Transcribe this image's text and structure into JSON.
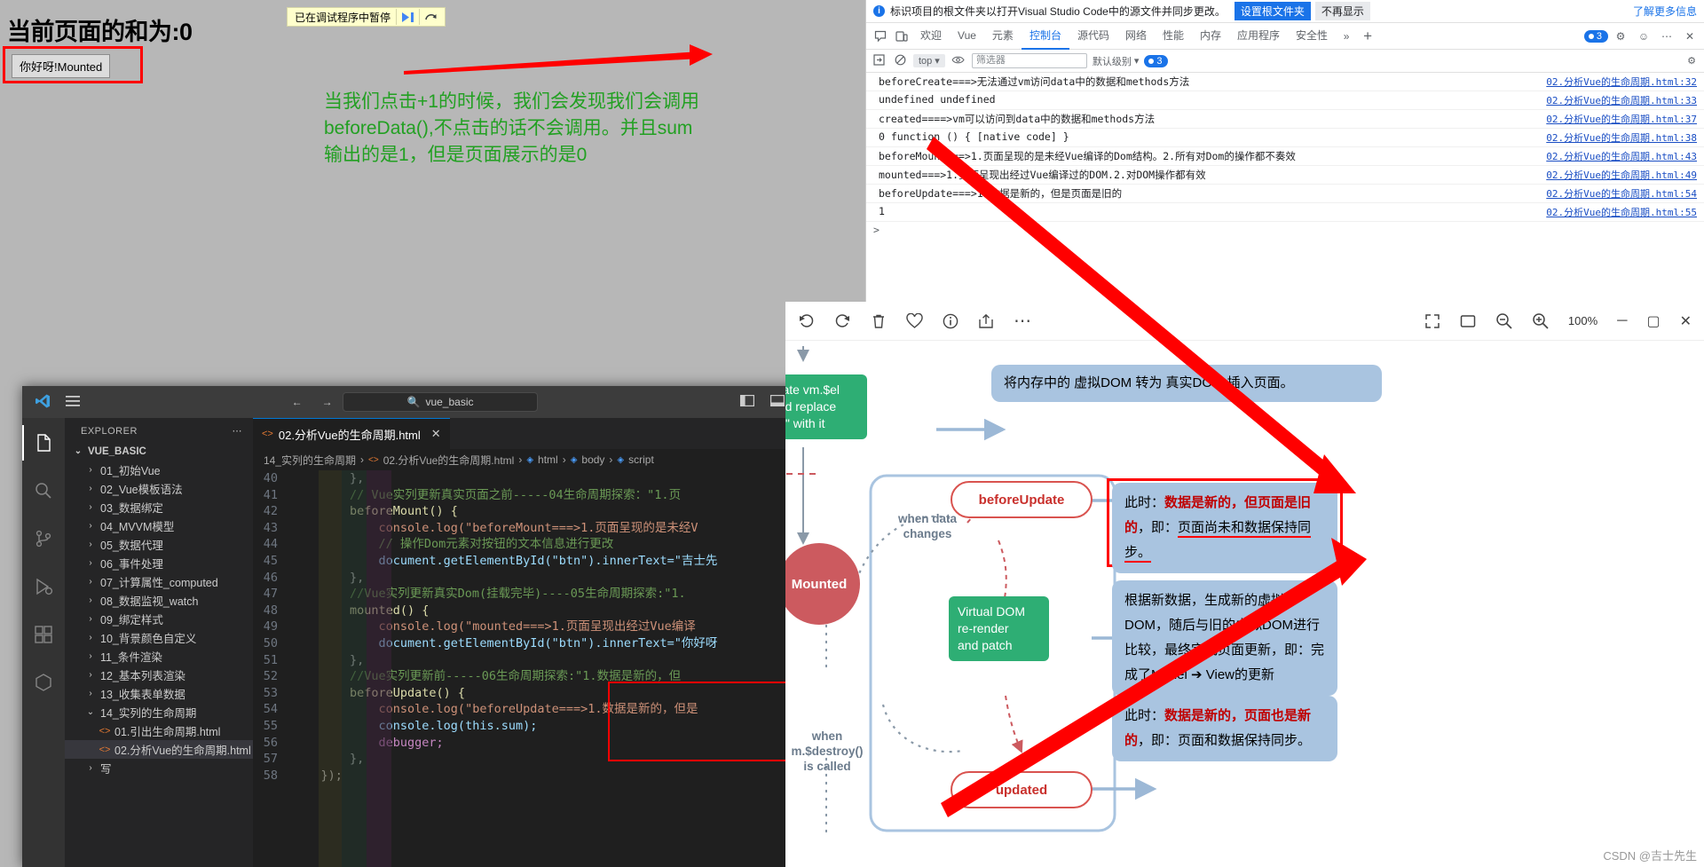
{
  "browser_page": {
    "heading": "当前页面的和为:0",
    "button_label": "你好呀!Mounted",
    "debug_bar": {
      "label": "已在调试程序中暂停",
      "resume_icon": "resume-icon",
      "step_icon": "step-over-icon"
    },
    "green_note_lines": [
      "当我们点击+1的时候，我们会发现我们会调用",
      "beforeData(),不点击的话不会调用。并且sum",
      "输出的是1，但是页面展示的是0"
    ],
    "green_color": "#22a022"
  },
  "devtools": {
    "banner": {
      "message": "标识项目的根文件夹以打开Visual Studio Code中的源文件并同步更改。",
      "primary_button": "设置根文件夹",
      "secondary_button": "不再显示",
      "more_link": "了解更多信息"
    },
    "tabs": [
      {
        "label": "欢迎",
        "active": false
      },
      {
        "label": "Vue",
        "active": false
      },
      {
        "label": "元素",
        "active": false
      },
      {
        "label": "控制台",
        "active": true
      },
      {
        "label": "源代码",
        "active": false
      },
      {
        "label": "网络",
        "active": false
      },
      {
        "label": "性能",
        "active": false
      },
      {
        "label": "内存",
        "active": false
      },
      {
        "label": "应用程序",
        "active": false
      },
      {
        "label": "安全性",
        "active": false
      }
    ],
    "tab_overflow": "»",
    "tab_add": "+",
    "issues_count": "3",
    "toolbar": {
      "context_select": "top",
      "filter_placeholder": "筛选器",
      "level_select": "默认级别",
      "messages_count": "3"
    },
    "console_rows": [
      {
        "msg": "beforeCreate===>无法通过vm访问data中的数据和methods方法",
        "src": "02.分析Vue的生命周期.html:32"
      },
      {
        "msg": "undefined undefined",
        "src": "02.分析Vue的生命周期.html:33"
      },
      {
        "msg": "created====>vm可以访问到data中的数据和methods方法",
        "src": "02.分析Vue的生命周期.html:37"
      },
      {
        "msg": "0 function () { [native code] }",
        "src": "02.分析Vue的生命周期.html:38"
      },
      {
        "msg": "beforeMount===>1.页面呈现的是未经Vue编译的Dom结构。2.所有对Dom的操作都不奏效",
        "src": "02.分析Vue的生命周期.html:43"
      },
      {
        "msg": "mounted===>1.页面呈现出经过Vue编译过的DOM.2.对DOM操作都有效",
        "src": "02.分析Vue的生命周期.html:49"
      },
      {
        "msg": "beforeUpdate===>1.数据是新的，但是页面是旧的",
        "src": "02.分析Vue的生命周期.html:54"
      },
      {
        "msg": "1",
        "src": "02.分析Vue的生命周期.html:55"
      }
    ],
    "prompt_symbol": ">"
  },
  "vscode": {
    "titlebar": {
      "menu_icon": "hamburger-icon",
      "back_icon": "arrow-left-icon",
      "forward_icon": "arrow-right-icon",
      "search_value": "vue_basic",
      "search_icon": "search-icon",
      "layout_icons": [
        "toggle-primary-sidebar-icon",
        "toggle-panel-icon",
        "toggle-secondary-sidebar-icon",
        "customize-layout-icon"
      ],
      "minimize": "─",
      "maximize": "▢",
      "close": "✕"
    },
    "activity_bar": [
      {
        "name": "explorer-icon",
        "active": true
      },
      {
        "name": "search-icon",
        "active": false
      },
      {
        "name": "source-control-icon",
        "active": false
      },
      {
        "name": "run-debug-icon",
        "active": false
      },
      {
        "name": "extensions-icon",
        "active": false
      },
      {
        "name": "remote-explorer-icon",
        "active": false
      }
    ],
    "sidebar": {
      "title": "EXPLORER",
      "more_icon": "more-actions-icon",
      "root": "VUE_BASIC",
      "items": [
        {
          "label": "01_初始Vue",
          "type": "folder",
          "expanded": false
        },
        {
          "label": "02_Vue模板语法",
          "type": "folder",
          "expanded": false
        },
        {
          "label": "03_数据绑定",
          "type": "folder",
          "expanded": false
        },
        {
          "label": "04_MVVM模型",
          "type": "folder",
          "expanded": false
        },
        {
          "label": "05_数据代理",
          "type": "folder",
          "expanded": false
        },
        {
          "label": "06_事件处理",
          "type": "folder",
          "expanded": false
        },
        {
          "label": "07_计算属性_computed",
          "type": "folder",
          "expanded": false
        },
        {
          "label": "08_数据监视_watch",
          "type": "folder",
          "expanded": false
        },
        {
          "label": "09_绑定样式",
          "type": "folder",
          "expanded": false
        },
        {
          "label": "10_背景颜色自定义",
          "type": "folder",
          "expanded": false
        },
        {
          "label": "11_条件渲染",
          "type": "folder",
          "expanded": false
        },
        {
          "label": "12_基本列表渲染",
          "type": "folder",
          "expanded": false
        },
        {
          "label": "13_收集表单数据",
          "type": "folder",
          "expanded": false
        },
        {
          "label": "14_实列的生命周期",
          "type": "folder",
          "expanded": true
        },
        {
          "label": "01.引出生命周期.html",
          "type": "file",
          "selected": false
        },
        {
          "label": "02.分析Vue的生命周期.html",
          "type": "file",
          "selected": true
        }
      ]
    },
    "tab": {
      "label": "02.分析Vue的生命周期.html",
      "close": "✕"
    },
    "tab_actions": [
      "run-icon",
      "split-editor-icon",
      "more-actions-icon"
    ],
    "breadcrumb": [
      "14_实列的生命周期",
      "02.分析Vue的生命周期.html",
      "html",
      "body",
      "script"
    ],
    "code_lines": [
      {
        "n": "40",
        "t": "        },",
        "plain": true
      },
      {
        "n": "41",
        "t": "        // Vue实列更新真实页面之前-----04生命周期探索：\"1.页",
        "kind": "comment"
      },
      {
        "n": "42",
        "t": "        beforeMount() {",
        "kind": "fn"
      },
      {
        "n": "43",
        "t": "            console.log(\"beforeMount===>1.页面呈现的是未经V",
        "kind": "log"
      },
      {
        "n": "44",
        "t": "            // 操作Dom元素对按钮的文本信息进行更改",
        "kind": "comment"
      },
      {
        "n": "45",
        "t": "            document.getElementById(\"btn\").innerText=\"吉士先",
        "kind": "dom"
      },
      {
        "n": "46",
        "t": "        },",
        "plain": true
      },
      {
        "n": "47",
        "t": "        //Vue实列更新真实Dom(挂载完毕)----05生命周期探索:\"1.",
        "kind": "comment"
      },
      {
        "n": "48",
        "t": "        mounted() {",
        "kind": "fn"
      },
      {
        "n": "49",
        "t": "            console.log(\"mounted===>1.页面呈现出经过Vue编译",
        "kind": "log"
      },
      {
        "n": "50",
        "t": "            document.getElementById(\"btn\").innerText=\"你好呀",
        "kind": "dom"
      },
      {
        "n": "51",
        "t": "        },",
        "plain": true
      },
      {
        "n": "52",
        "t": "        //Vue实列更新前-----06生命周期探索:\"1.数据是新的，但",
        "kind": "comment"
      },
      {
        "n": "53",
        "t": "        beforeUpdate() {",
        "kind": "fn"
      },
      {
        "n": "54",
        "t": "            console.log(\"beforeUpdate===>1.数据是新的，但是",
        "kind": "log"
      },
      {
        "n": "55",
        "t": "            console.log(this.sum);",
        "kind": "logthis"
      },
      {
        "n": "56",
        "t": "            debugger;",
        "kind": "debugger"
      },
      {
        "n": "57",
        "t": "        },",
        "plain": true
      },
      {
        "n": "58",
        "t": "    });",
        "plain": true
      }
    ]
  },
  "diagram": {
    "toolbar": {
      "icons": [
        "rotate-left-icon",
        "rotate-right-icon",
        "delete-icon",
        "favorite-icon",
        "info-icon",
        "share-icon",
        "more-icon"
      ],
      "right_icons": [
        "fit-screen-icon",
        "actual-size-icon",
        "zoom-out-icon",
        "zoom-in-icon"
      ],
      "zoom_level": "100%",
      "window_minimize": "─",
      "window_maximize": "▢",
      "window_close": "✕"
    },
    "nodes": [
      {
        "name": "create-el-node",
        "label": "reate vm.$el\nand replace\n\"el\" with it",
        "type": "green"
      },
      {
        "name": "mounted-node",
        "label": "Mounted",
        "type": "circle"
      },
      {
        "name": "before-update-node",
        "label": "beforeUpdate",
        "type": "pill"
      },
      {
        "name": "virtual-dom-node",
        "label": "Virtual DOM\nre-render\nand patch",
        "type": "green"
      },
      {
        "name": "updated-node",
        "label": "updated",
        "type": "pill"
      }
    ],
    "labels": [
      {
        "name": "when-data-changes-label",
        "text": "when data\nchanges"
      },
      {
        "name": "when-destroy-label",
        "text": "when\nm.$destroy()\nis called"
      }
    ],
    "callouts": [
      {
        "name": "callout-real-dom",
        "text": "将内存中的 虚拟DOM 转为 真实DOM 插入页面。"
      },
      {
        "name": "callout-before-update",
        "prefix": "此时：",
        "bold": "数据是新的，但页面是旧的",
        "suffix": "，即：",
        "underlined": "页面尚未和数据保持同步。"
      },
      {
        "name": "callout-virtual-dom",
        "text": "根据新数据，生成新的虚拟DOM，随后与旧的虚拟DOM进行比较，最终完成页面更新，即：完成了Model ➔ View的更新"
      },
      {
        "name": "callout-updated",
        "prefix": "此时：",
        "bold": "数据是新的，页面也是新的",
        "suffix": "，即：页面和数据保持同步。"
      }
    ],
    "watermark": "CSDN @吉士先生"
  }
}
